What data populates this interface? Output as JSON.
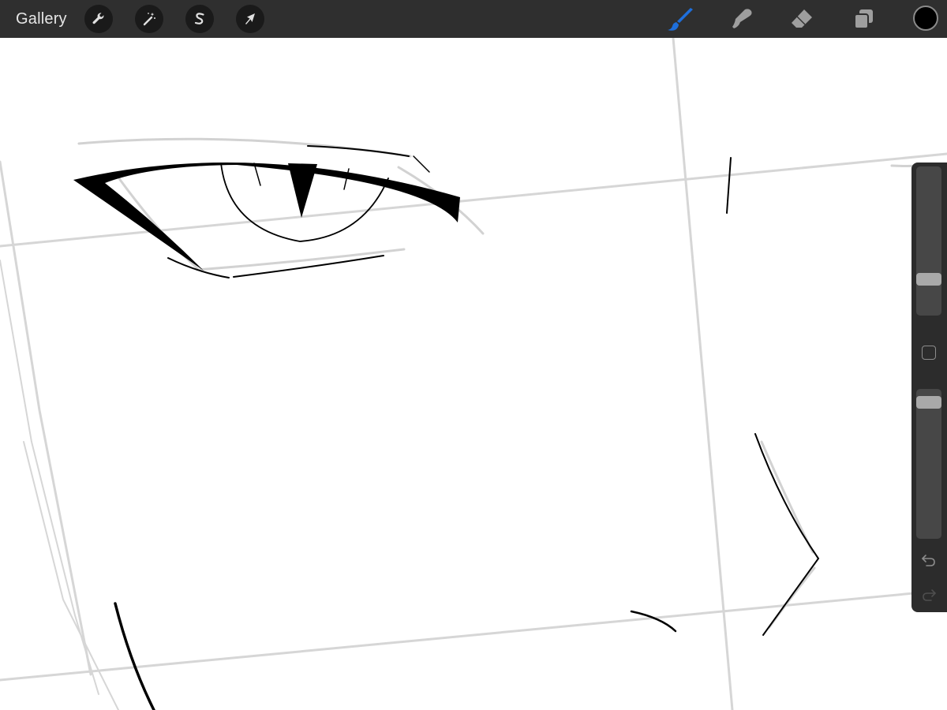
{
  "topbar": {
    "gallery_label": "Gallery",
    "left_tools": [
      {
        "name": "actions-wrench-icon"
      },
      {
        "name": "adjustments-wand-icon"
      },
      {
        "name": "selection-s-icon"
      },
      {
        "name": "transform-arrow-icon"
      }
    ],
    "right_tools": [
      {
        "name": "brush-icon",
        "active": true
      },
      {
        "name": "smudge-icon",
        "active": false
      },
      {
        "name": "eraser-icon",
        "active": false
      },
      {
        "name": "layers-icon",
        "active": false
      }
    ],
    "current_color": "#000000"
  },
  "colors": {
    "topbar_bg": "#2f2f2f",
    "active_tool": "#1e6fdc",
    "inactive_tool": "#a0a0a0",
    "guide_gray": "#d4d4d4",
    "ink": "#000000"
  },
  "sidebar": {
    "brush_size_level": 0.78,
    "opacity_level": 0.05,
    "modifier_icon": "modifier-square-icon",
    "undo_icon": "undo-arrow-icon",
    "redo_icon": "redo-arrow-icon"
  }
}
